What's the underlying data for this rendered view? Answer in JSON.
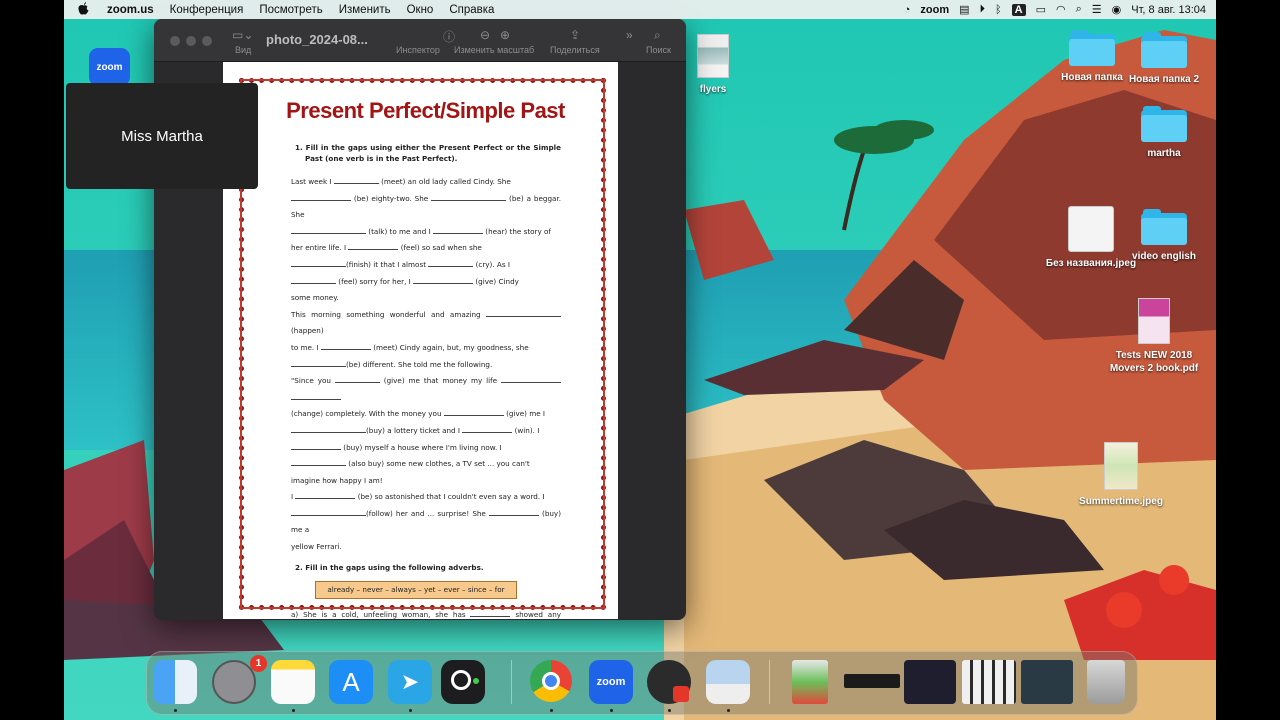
{
  "menubar": {
    "apple": "",
    "app": "zoom.us",
    "items": [
      "Конференция",
      "Посмотреть",
      "Изменить",
      "Окно",
      "Справка"
    ],
    "zoom_label": "zoom",
    "datetime": "Чт, 8 авг.  13:04"
  },
  "preview": {
    "title": "photo_2024-08...",
    "toolbar": {
      "view": "Вид",
      "inspector": "Инспектор",
      "zoom": "Изменить масштаб",
      "share": "Поделиться",
      "search": "Поиск"
    }
  },
  "document": {
    "title": "Present Perfect/Simple Past",
    "ex1_title": "1.  Fill in the gaps using either the Present Perfect or the Simple Past (one verb is in the Past Perfect).",
    "ex1_lines": [
      [
        "Last week I ",
        " (meet) an old lady called Cindy. She "
      ],
      [
        "",
        " (be) eighty-two. She ",
        " (be) a beggar. She "
      ],
      [
        "",
        " (talk) to me and I ",
        " (hear) the story of "
      ],
      [
        "her entire life. I ",
        " (feel) so sad when she "
      ],
      [
        "",
        "(finish) it that I almost ",
        " (cry). As I "
      ],
      [
        "",
        " (feel) sorry for her, I ",
        " (give) Cindy "
      ],
      [
        "some money."
      ],
      [
        "This morning something wonderful and amazing ",
        " (happen) "
      ],
      [
        "to me. I ",
        " (meet) Cindy again, but, my goodness, she "
      ],
      [
        "",
        "(be) different. She told me the following."
      ],
      [
        "\"Since you ",
        " (give) me that money my life ",
        ""
      ],
      [
        "(change) completely. With the money you ",
        " (give) me I "
      ],
      [
        "",
        "(buy) a lottery ticket and I ",
        " (win). I "
      ],
      [
        "",
        " (buy) myself a house where I'm living now. I "
      ],
      [
        "",
        " (also buy) some new clothes, a TV set ... you can't "
      ],
      [
        "imagine how happy I am!"
      ],
      [
        "I ",
        " (be) so astonished that I couldn't even say a word. I "
      ],
      [
        "",
        "(follow) her and ... surprise! She ",
        " (buy) me a "
      ],
      [
        "yellow Ferrari."
      ]
    ],
    "ex2_title": "2.  Fill in the gaps using the following adverbs.",
    "adverbs": "already – never – always – yet – ever – since – for",
    "ex2_line_a": [
      "a)  She is a cold, unfeeling woman, she has ",
      " showed any affection."
    ]
  },
  "participant": {
    "name": "Miss Martha"
  },
  "zoom_badge": "zoom",
  "desktop_icons": [
    {
      "label": "flyers"
    },
    {
      "label": "Новая папка"
    },
    {
      "label": "Новая папка 2"
    },
    {
      "label": "martha"
    },
    {
      "label": "Без названия.jpeg"
    },
    {
      "label": "video  english"
    },
    {
      "label": "Tests NEW 2018 Movers 2 book.pdf"
    },
    {
      "label": "Summertime.jpeg"
    }
  ],
  "dock": {
    "badge": "1",
    "zoom_label": "zoom",
    "apps": [
      "finder-icon",
      "system-settings-icon",
      "notes-icon",
      "app-store-icon",
      "telegram-icon",
      "camera-icon",
      "chrome-icon",
      "zoom-icon",
      "obs-icon",
      "preview-icon",
      "thumbnail-1",
      "thumbnail-2",
      "thumbnail-3",
      "thumbnail-4",
      "thumbnail-5",
      "trash-icon"
    ]
  },
  "colors": {
    "accent_zoom": "#1f63e8",
    "doc_title": "#a31515",
    "adverb_box": "#f7c98c",
    "folder": "#2fb5e8"
  }
}
